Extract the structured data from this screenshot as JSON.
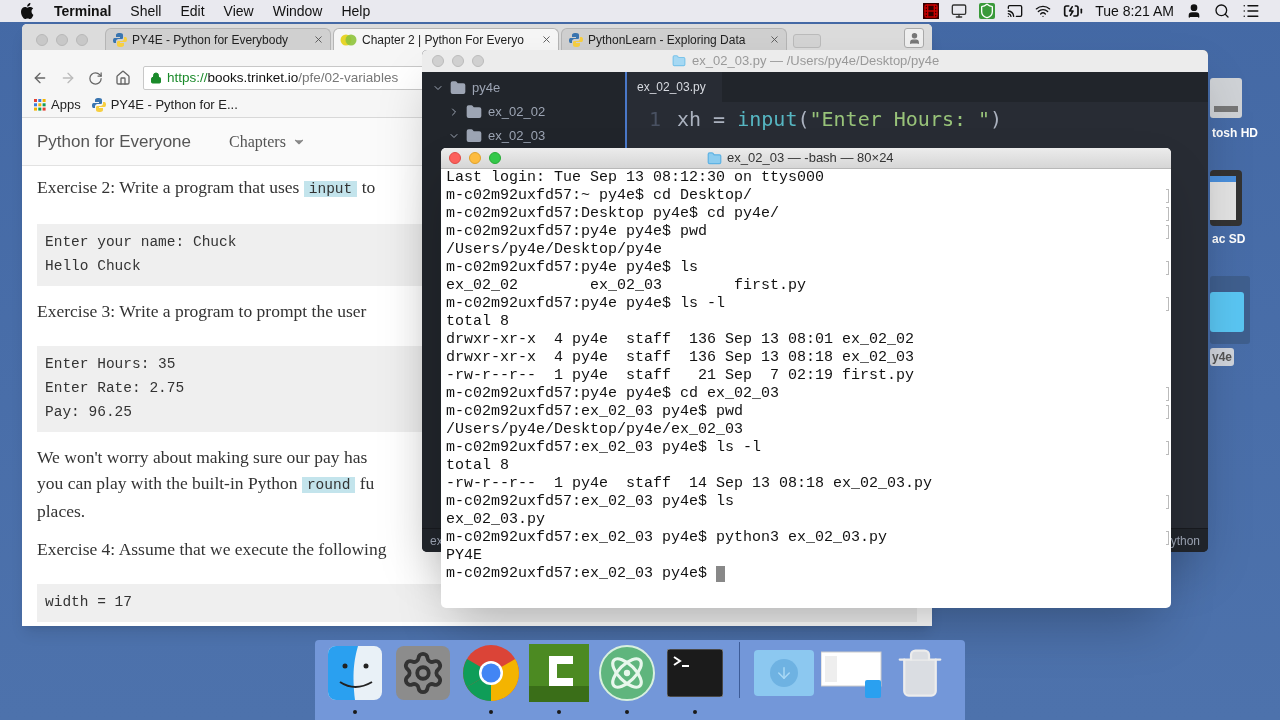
{
  "menu_bar": {
    "app": "Terminal",
    "menus": [
      "Shell",
      "Edit",
      "View",
      "Window",
      "Help"
    ],
    "clock": "Tue 8:21 AM"
  },
  "browser": {
    "tabs": [
      {
        "title": "PY4E - Python for Everybody",
        "selected": false,
        "kind": "python"
      },
      {
        "title": "Chapter 2 | Python For Everyo",
        "selected": true,
        "kind": "trinket"
      },
      {
        "title": "PythonLearn - Exploring Data",
        "selected": false,
        "kind": "python"
      }
    ],
    "url": {
      "scheme": "https://",
      "host": "books.trinket.io",
      "path": "/pfe/02-variables"
    },
    "bookmarks": [
      "Apps",
      "PY4E - Python for E..."
    ],
    "site_title": "Python for Everyone",
    "nav_menu": "Chapters",
    "content": [
      {
        "kind": "paragraph",
        "lines": [
          [
            {
              "kind": "text",
              "text": "Exercise 2: Write a program that uses "
            },
            {
              "kind": "code",
              "text": "input"
            },
            {
              "kind": "text",
              "text": " to"
            }
          ]
        ]
      },
      {
        "kind": "code_block",
        "lines": [
          "Enter your name: Chuck",
          "Hello Chuck"
        ]
      },
      {
        "kind": "paragraph",
        "lines": [
          [
            {
              "kind": "text",
              "text": "Exercise 3: Write a program to prompt the user"
            }
          ]
        ]
      },
      {
        "kind": "code_block",
        "lines": [
          "Enter Hours: 35",
          "Enter Rate: 2.75",
          "Pay: 96.25"
        ]
      },
      {
        "kind": "paragraph",
        "lines": [
          [
            {
              "kind": "text",
              "text": "We won't worry about making sure our pay has"
            }
          ],
          [
            {
              "kind": "text",
              "text": "you can play with the built-in Python "
            },
            {
              "kind": "code",
              "text": "round"
            },
            {
              "kind": "text",
              "text": " fu"
            }
          ],
          [
            {
              "kind": "text",
              "text": "places."
            }
          ]
        ]
      },
      {
        "kind": "paragraph",
        "lines": [
          [
            {
              "kind": "text",
              "text": "Exercise 4: Assume that we execute the following"
            }
          ]
        ]
      },
      {
        "kind": "code_block",
        "lines": [
          "width = 17"
        ]
      }
    ]
  },
  "editor": {
    "title": "ex_02_03.py — /Users/py4e/Desktop/py4e",
    "tree": [
      {
        "name": "py4e",
        "expanded": true,
        "children": [
          {
            "name": "ex_02_02",
            "expanded": false
          },
          {
            "name": "ex_02_03",
            "expanded": true
          }
        ]
      }
    ],
    "tab": "ex_02_03.py",
    "line_number": "1",
    "code": [
      {
        "kind": "plain",
        "text": "xh = "
      },
      {
        "kind": "function",
        "text": "input"
      },
      {
        "kind": "plain",
        "text": "("
      },
      {
        "kind": "string",
        "text": "\"Enter Hours: \""
      },
      {
        "kind": "plain",
        "text": ")"
      }
    ],
    "status_left": "ex",
    "status_right": "ython"
  },
  "terminal": {
    "title": "ex_02_03 — -bash — 80×24",
    "lines": [
      {
        "text": "Last login: Tue Sep 13 08:12:30 on ttys000",
        "marked": false
      },
      {
        "text": "m-c02m92uxfd57:~ py4e$ cd Desktop/",
        "marked": true
      },
      {
        "text": "m-c02m92uxfd57:Desktop py4e$ cd py4e/",
        "marked": true
      },
      {
        "text": "m-c02m92uxfd57:py4e py4e$ pwd",
        "marked": true
      },
      {
        "text": "/Users/py4e/Desktop/py4e",
        "marked": false
      },
      {
        "text": "m-c02m92uxfd57:py4e py4e$ ls",
        "marked": true
      },
      {
        "text": "ex_02_02        ex_02_03        first.py",
        "marked": false
      },
      {
        "text": "m-c02m92uxfd57:py4e py4e$ ls -l",
        "marked": true
      },
      {
        "text": "total 8",
        "marked": false
      },
      {
        "text": "drwxr-xr-x  4 py4e  staff  136 Sep 13 08:01 ex_02_02",
        "marked": false
      },
      {
        "text": "drwxr-xr-x  4 py4e  staff  136 Sep 13 08:18 ex_02_03",
        "marked": false
      },
      {
        "text": "-rw-r--r--  1 py4e  staff   21 Sep  7 02:19 first.py",
        "marked": false
      },
      {
        "text": "m-c02m92uxfd57:py4e py4e$ cd ex_02_03",
        "marked": true
      },
      {
        "text": "m-c02m92uxfd57:ex_02_03 py4e$ pwd",
        "marked": true
      },
      {
        "text": "/Users/py4e/Desktop/py4e/ex_02_03",
        "marked": false
      },
      {
        "text": "m-c02m92uxfd57:ex_02_03 py4e$ ls -l",
        "marked": true
      },
      {
        "text": "total 8",
        "marked": false
      },
      {
        "text": "-rw-r--r--  1 py4e  staff  14 Sep 13 08:18 ex_02_03.py",
        "marked": false
      },
      {
        "text": "m-c02m92uxfd57:ex_02_03 py4e$ ls",
        "marked": true
      },
      {
        "text": "ex_02_03.py",
        "marked": false
      },
      {
        "text": "m-c02m92uxfd57:ex_02_03 py4e$ python3 ex_02_03.py",
        "marked": true
      },
      {
        "text": "PY4E",
        "marked": false
      },
      {
        "text": "m-c02m92uxfd57:ex_02_03 py4e$ ",
        "marked": false
      }
    ]
  },
  "desktop_icons": [
    {
      "kind": "drive",
      "label": "tosh HD",
      "selected": false
    },
    {
      "kind": "sdcard",
      "label": "ac SD",
      "selected": false
    },
    {
      "kind": "folder",
      "label": "y4e",
      "selected": true
    }
  ],
  "dock": [
    {
      "kind": "finder",
      "running": true
    },
    {
      "kind": "settings",
      "running": false
    },
    {
      "kind": "chrome",
      "running": true
    },
    {
      "kind": "camtasia",
      "running": true
    },
    {
      "kind": "atom",
      "running": true
    },
    {
      "kind": "terminal",
      "running": true
    },
    {
      "kind": "separator"
    },
    {
      "kind": "downloads"
    },
    {
      "kind": "window"
    },
    {
      "kind": "trash"
    }
  ]
}
